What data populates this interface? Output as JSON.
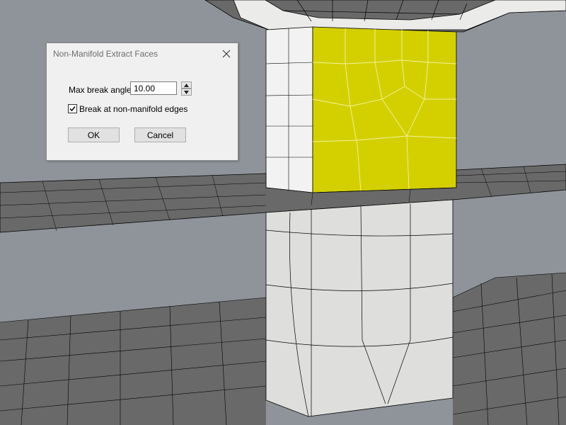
{
  "dialog": {
    "title": "Non-Manifold Extract Faces",
    "max_break_angle_label": "Max break angle",
    "max_break_angle_value": "10.00",
    "break_checkbox_label": "Break at non-manifold edges",
    "break_checkbox_checked": true,
    "ok_label": "OK",
    "cancel_label": "Cancel",
    "close_icon": "close-icon"
  },
  "viewport": {
    "background_color": "#8f949a",
    "mesh_dark_color": "#6a6a6a",
    "mesh_light_color": "#e2e2e0",
    "selected_face_color": "#d4d000",
    "wire_color": "#000000",
    "selection_wire_color": "#f4f2a0"
  }
}
